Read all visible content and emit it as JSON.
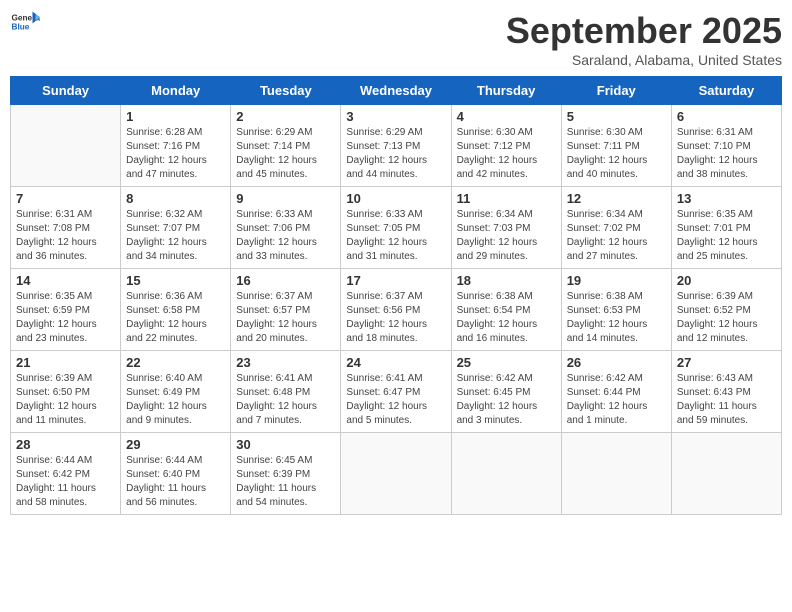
{
  "header": {
    "logo_general": "General",
    "logo_blue": "Blue",
    "month": "September 2025",
    "location": "Saraland, Alabama, United States"
  },
  "weekdays": [
    "Sunday",
    "Monday",
    "Tuesday",
    "Wednesday",
    "Thursday",
    "Friday",
    "Saturday"
  ],
  "weeks": [
    [
      {
        "day": "",
        "info": ""
      },
      {
        "day": "1",
        "info": "Sunrise: 6:28 AM\nSunset: 7:16 PM\nDaylight: 12 hours\nand 47 minutes."
      },
      {
        "day": "2",
        "info": "Sunrise: 6:29 AM\nSunset: 7:14 PM\nDaylight: 12 hours\nand 45 minutes."
      },
      {
        "day": "3",
        "info": "Sunrise: 6:29 AM\nSunset: 7:13 PM\nDaylight: 12 hours\nand 44 minutes."
      },
      {
        "day": "4",
        "info": "Sunrise: 6:30 AM\nSunset: 7:12 PM\nDaylight: 12 hours\nand 42 minutes."
      },
      {
        "day": "5",
        "info": "Sunrise: 6:30 AM\nSunset: 7:11 PM\nDaylight: 12 hours\nand 40 minutes."
      },
      {
        "day": "6",
        "info": "Sunrise: 6:31 AM\nSunset: 7:10 PM\nDaylight: 12 hours\nand 38 minutes."
      }
    ],
    [
      {
        "day": "7",
        "info": "Sunrise: 6:31 AM\nSunset: 7:08 PM\nDaylight: 12 hours\nand 36 minutes."
      },
      {
        "day": "8",
        "info": "Sunrise: 6:32 AM\nSunset: 7:07 PM\nDaylight: 12 hours\nand 34 minutes."
      },
      {
        "day": "9",
        "info": "Sunrise: 6:33 AM\nSunset: 7:06 PM\nDaylight: 12 hours\nand 33 minutes."
      },
      {
        "day": "10",
        "info": "Sunrise: 6:33 AM\nSunset: 7:05 PM\nDaylight: 12 hours\nand 31 minutes."
      },
      {
        "day": "11",
        "info": "Sunrise: 6:34 AM\nSunset: 7:03 PM\nDaylight: 12 hours\nand 29 minutes."
      },
      {
        "day": "12",
        "info": "Sunrise: 6:34 AM\nSunset: 7:02 PM\nDaylight: 12 hours\nand 27 minutes."
      },
      {
        "day": "13",
        "info": "Sunrise: 6:35 AM\nSunset: 7:01 PM\nDaylight: 12 hours\nand 25 minutes."
      }
    ],
    [
      {
        "day": "14",
        "info": "Sunrise: 6:35 AM\nSunset: 6:59 PM\nDaylight: 12 hours\nand 23 minutes."
      },
      {
        "day": "15",
        "info": "Sunrise: 6:36 AM\nSunset: 6:58 PM\nDaylight: 12 hours\nand 22 minutes."
      },
      {
        "day": "16",
        "info": "Sunrise: 6:37 AM\nSunset: 6:57 PM\nDaylight: 12 hours\nand 20 minutes."
      },
      {
        "day": "17",
        "info": "Sunrise: 6:37 AM\nSunset: 6:56 PM\nDaylight: 12 hours\nand 18 minutes."
      },
      {
        "day": "18",
        "info": "Sunrise: 6:38 AM\nSunset: 6:54 PM\nDaylight: 12 hours\nand 16 minutes."
      },
      {
        "day": "19",
        "info": "Sunrise: 6:38 AM\nSunset: 6:53 PM\nDaylight: 12 hours\nand 14 minutes."
      },
      {
        "day": "20",
        "info": "Sunrise: 6:39 AM\nSunset: 6:52 PM\nDaylight: 12 hours\nand 12 minutes."
      }
    ],
    [
      {
        "day": "21",
        "info": "Sunrise: 6:39 AM\nSunset: 6:50 PM\nDaylight: 12 hours\nand 11 minutes."
      },
      {
        "day": "22",
        "info": "Sunrise: 6:40 AM\nSunset: 6:49 PM\nDaylight: 12 hours\nand 9 minutes."
      },
      {
        "day": "23",
        "info": "Sunrise: 6:41 AM\nSunset: 6:48 PM\nDaylight: 12 hours\nand 7 minutes."
      },
      {
        "day": "24",
        "info": "Sunrise: 6:41 AM\nSunset: 6:47 PM\nDaylight: 12 hours\nand 5 minutes."
      },
      {
        "day": "25",
        "info": "Sunrise: 6:42 AM\nSunset: 6:45 PM\nDaylight: 12 hours\nand 3 minutes."
      },
      {
        "day": "26",
        "info": "Sunrise: 6:42 AM\nSunset: 6:44 PM\nDaylight: 12 hours\nand 1 minute."
      },
      {
        "day": "27",
        "info": "Sunrise: 6:43 AM\nSunset: 6:43 PM\nDaylight: 11 hours\nand 59 minutes."
      }
    ],
    [
      {
        "day": "28",
        "info": "Sunrise: 6:44 AM\nSunset: 6:42 PM\nDaylight: 11 hours\nand 58 minutes."
      },
      {
        "day": "29",
        "info": "Sunrise: 6:44 AM\nSunset: 6:40 PM\nDaylight: 11 hours\nand 56 minutes."
      },
      {
        "day": "30",
        "info": "Sunrise: 6:45 AM\nSunset: 6:39 PM\nDaylight: 11 hours\nand 54 minutes."
      },
      {
        "day": "",
        "info": ""
      },
      {
        "day": "",
        "info": ""
      },
      {
        "day": "",
        "info": ""
      },
      {
        "day": "",
        "info": ""
      }
    ]
  ]
}
